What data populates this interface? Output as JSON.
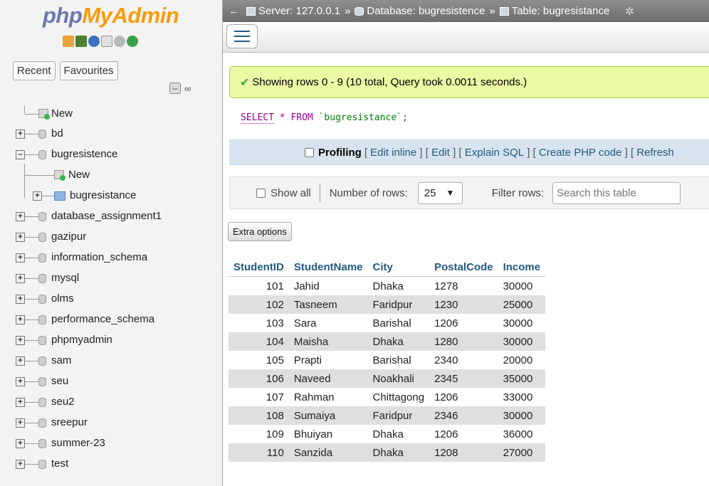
{
  "nav": {
    "logo_php": "php",
    "logo_myadmin": "MyAdmin",
    "icons": [
      "home-icon",
      "exit-icon",
      "help-icon",
      "docs-icon",
      "settings-icon",
      "reload-icon"
    ],
    "tabs": [
      "Recent",
      "Favourites"
    ],
    "collapse_symbol": "–",
    "link_symbol": "∞",
    "tree": [
      {
        "label": "New"
      },
      {
        "label": "bd"
      },
      {
        "label": "bugresistence"
      },
      {
        "label": "New"
      },
      {
        "label": "bugresistance"
      },
      {
        "label": "database_assignment1"
      },
      {
        "label": "gazipur"
      },
      {
        "label": "information_schema"
      },
      {
        "label": "mysql"
      },
      {
        "label": "olms"
      },
      {
        "label": "performance_schema"
      },
      {
        "label": "phpmyadmin"
      },
      {
        "label": "sam"
      },
      {
        "label": "seu"
      },
      {
        "label": "seu2"
      },
      {
        "label": "sreepur"
      },
      {
        "label": "summer-23"
      },
      {
        "label": "test"
      }
    ]
  },
  "topbar": {
    "back": "←",
    "server": "Server: 127.0.0.1",
    "database": "Database: bugresistence",
    "table": "Table: bugresistance",
    "sep": "»",
    "gear": "✲"
  },
  "main": {
    "success_check": "✔",
    "success_message": "Showing rows 0 - 9 (10 total, Query took 0.0011 seconds.)",
    "sql": {
      "kw1": "SELECT",
      "star": "*",
      "kw2": "FROM",
      "table": "`bugresistance`",
      "end": ";"
    },
    "profiling": "Profiling",
    "actions": [
      {
        "label": "Edit inline"
      },
      {
        "label": "Edit"
      },
      {
        "label": "Explain SQL"
      },
      {
        "label": "Create PHP code"
      },
      {
        "label": "Refresh"
      }
    ],
    "show_all": "Show all",
    "number_of_rows_label": "Number of rows:",
    "number_of_rows_value": "25",
    "chevron": "⌄",
    "filter_label": "Filter rows:",
    "filter_placeholder": "Search this table",
    "extra_options": "Extra options"
  },
  "table": {
    "columns": [
      "StudentID",
      "StudentName",
      "City",
      "PostalCode",
      "Income"
    ],
    "rows": [
      [
        "101",
        "Jahid",
        "Dhaka",
        "1278",
        "30000"
      ],
      [
        "102",
        "Tasneem",
        "Faridpur",
        "1230",
        "25000"
      ],
      [
        "103",
        "Sara",
        "Barishal",
        "1206",
        "30000"
      ],
      [
        "104",
        "Maisha",
        "Dhaka",
        "1280",
        "30000"
      ],
      [
        "105",
        "Prapti",
        "Barishal",
        "2340",
        "20000"
      ],
      [
        "106",
        "Naveed",
        "Noakhali",
        "2345",
        "35000"
      ],
      [
        "107",
        "Rahman",
        "Chittagong",
        "1206",
        "33000"
      ],
      [
        "108",
        "Sumaiya",
        "Faridpur",
        "2346",
        "30000"
      ],
      [
        "109",
        "Bhuiyan",
        "Dhaka",
        "1206",
        "36000"
      ],
      [
        "110",
        "Sanzida",
        "Dhaka",
        "1208",
        "27000"
      ]
    ]
  },
  "colors": {
    "link": "#235a81",
    "success_bg": "#ebf8a4",
    "topbar": "#777777",
    "row_alt": "#dfdfdf"
  }
}
